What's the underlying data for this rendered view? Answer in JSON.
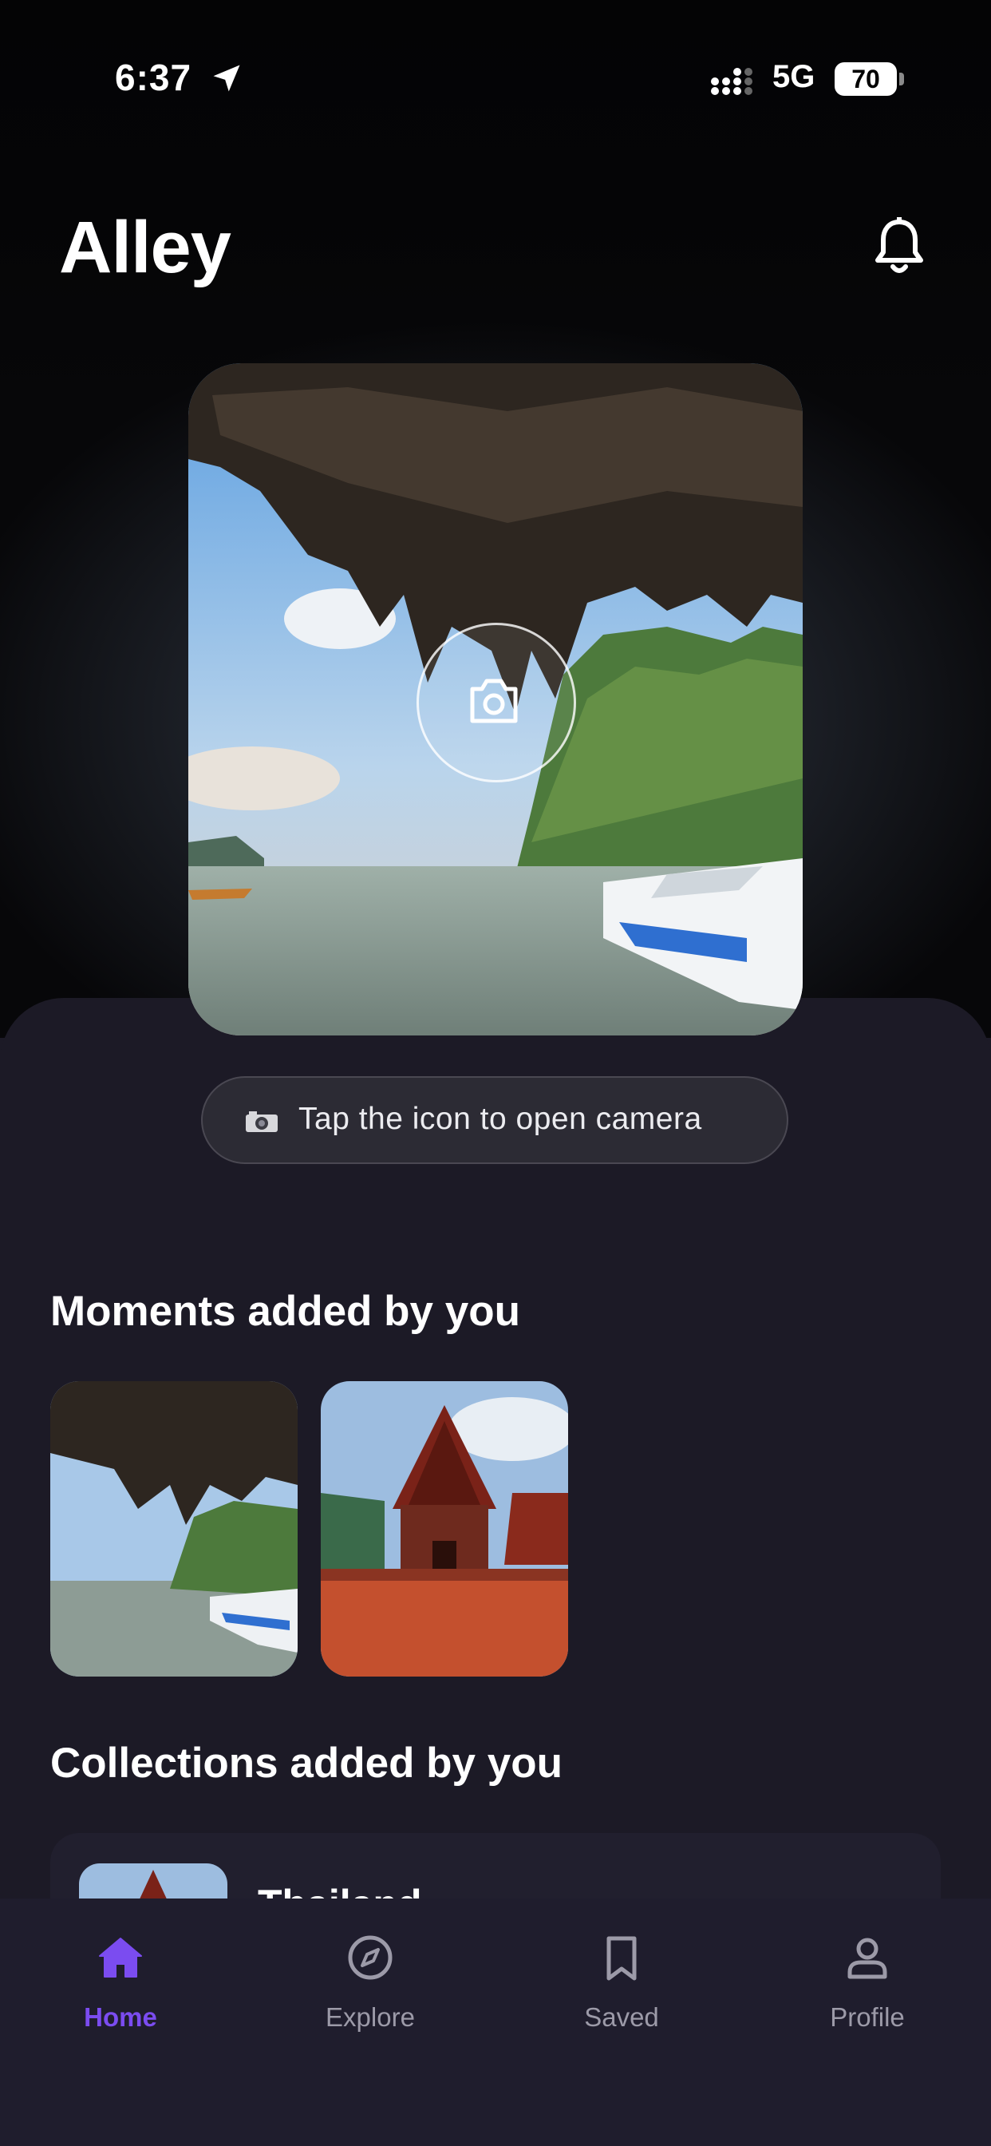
{
  "status_bar": {
    "time": "6:37",
    "network": "5G",
    "battery": "70"
  },
  "header": {
    "title": "Alley"
  },
  "camera_hint": {
    "label": "Tap the icon to open camera"
  },
  "moments": {
    "title": "Moments added by you",
    "items": [
      "cave-boat-photo",
      "thai-temple-photo"
    ]
  },
  "collections": {
    "title": "Collections added by you",
    "items": [
      {
        "name": "Thailand"
      }
    ]
  },
  "tabs": [
    {
      "label": "Home",
      "icon": "home-icon",
      "active": true
    },
    {
      "label": "Explore",
      "icon": "compass-icon",
      "active": false
    },
    {
      "label": "Saved",
      "icon": "bookmark-icon",
      "active": false
    },
    {
      "label": "Profile",
      "icon": "person-icon",
      "active": false
    }
  ],
  "colors": {
    "accent": "#7b4cf0",
    "background": "#1c1a26",
    "tabbar": "#1f1d2d"
  }
}
